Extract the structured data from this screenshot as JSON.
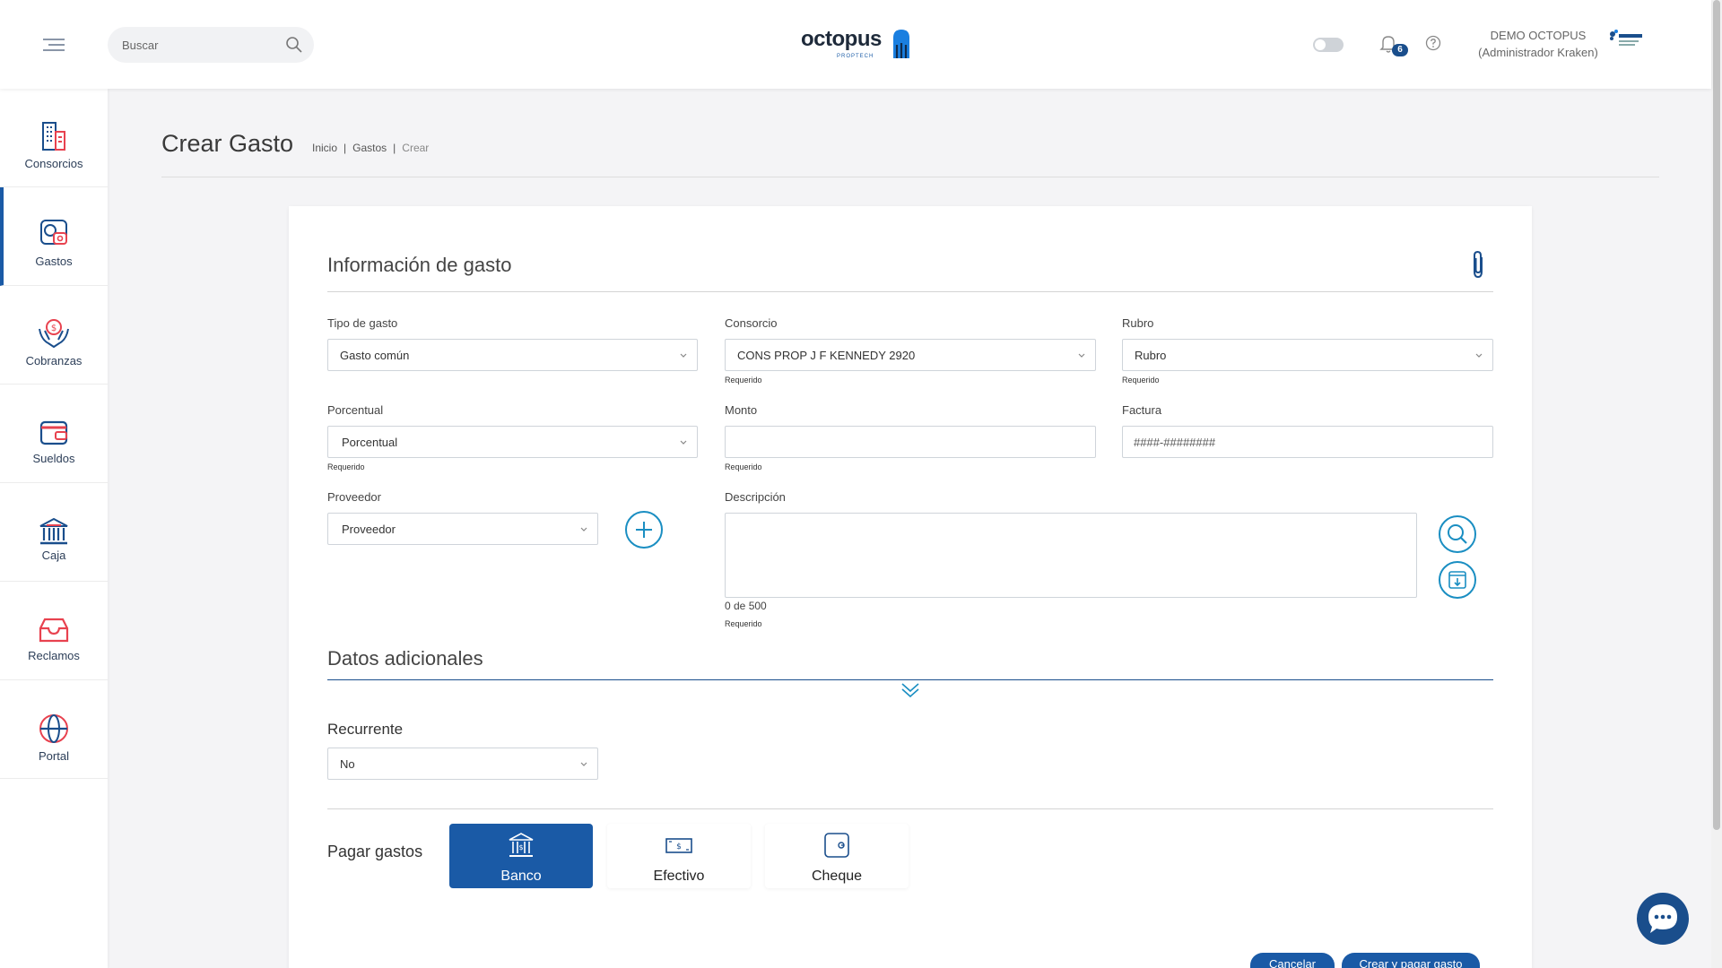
{
  "header": {
    "search_placeholder": "Buscar",
    "logo_text": "octopus",
    "logo_sub": "PROPTECH",
    "notification_count": "6",
    "user_name": "DEMO OCTOPUS",
    "user_role": "(Administrador Kraken)"
  },
  "sidebar": {
    "items": [
      {
        "label": "Consorcios",
        "icon": "building-icon"
      },
      {
        "label": "Gastos",
        "icon": "expense-icon"
      },
      {
        "label": "Cobranzas",
        "icon": "collection-icon"
      },
      {
        "label": "Sueldos",
        "icon": "wallet-icon"
      },
      {
        "label": "Caja",
        "icon": "bank-icon"
      },
      {
        "label": "Reclamos",
        "icon": "inbox-icon"
      },
      {
        "label": "Portal",
        "icon": "globe-icon"
      }
    ],
    "active_index": 1
  },
  "page": {
    "title": "Crear Gasto",
    "breadcrumb": [
      "Inicio",
      "Gastos",
      "Crear"
    ]
  },
  "form": {
    "section_title": "Información de gasto",
    "tipo_label": "Tipo de gasto",
    "tipo_value": "Gasto común",
    "consorcio_label": "Consorcio",
    "consorcio_value": "CONS PROP J F KENNEDY 2920",
    "rubro_label": "Rubro",
    "rubro_value": "Rubro",
    "porcentual_label": "Porcentual",
    "porcentual_value": "Porcentual",
    "monto_label": "Monto",
    "monto_value": "",
    "factura_label": "Factura",
    "factura_placeholder": "####-########",
    "proveedor_label": "Proveedor",
    "proveedor_value": "Proveedor",
    "descripcion_label": "Descripción",
    "descripcion_counter": "0 de 500",
    "required_text": "Requerido"
  },
  "additional": {
    "title": "Datos adicionales",
    "recurrente_label": "Recurrente",
    "recurrente_value": "No"
  },
  "payment": {
    "title": "Pagar gastos",
    "options": [
      "Banco",
      "Efectivo",
      "Cheque"
    ],
    "selected": "Banco"
  },
  "actions": {
    "cancel_label": "Cancelar",
    "create_pay_label": "Crear y pagar gasto"
  },
  "colors": {
    "primary": "#1a5aa6",
    "accent": "#1a8ec2",
    "danger": "#e8424f"
  }
}
